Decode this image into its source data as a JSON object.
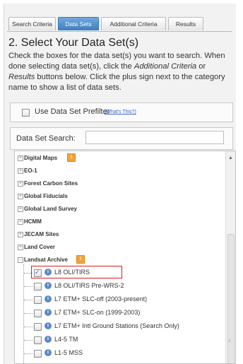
{
  "tabs": [
    {
      "label": "Search Criteria",
      "active": false
    },
    {
      "label": "Data Sets",
      "active": true
    },
    {
      "label": "Additional Criteria",
      "active": false
    },
    {
      "label": "Results",
      "active": false
    }
  ],
  "section": {
    "title": "2. Select Your Data Set(s)",
    "instr_1": "Check the boxes for the data set(s) you want to search. When done selecting data set(s), click the ",
    "instr_additional": "Additional Criteria",
    "instr_2": " or ",
    "instr_results": "Results",
    "instr_3": " buttons below. Click the plus sign next to the category name to show a list of data sets."
  },
  "prefilter": {
    "label": "Use Data Set Prefilter",
    "link": "(What's This?)",
    "checked": false
  },
  "search": {
    "label": "Data Set Search:",
    "value": "",
    "placeholder": ""
  },
  "tree": {
    "categories": [
      {
        "label": "Digital Maps",
        "badge": true
      },
      {
        "label": "EO-1",
        "badge": false
      },
      {
        "label": "Forest Carbon Sites",
        "badge": false
      },
      {
        "label": "Global Fiducials",
        "badge": false
      },
      {
        "label": "Global Land Survey",
        "badge": false
      },
      {
        "label": "HCMM",
        "badge": false
      },
      {
        "label": "JECAM Sites",
        "badge": false
      },
      {
        "label": "Land Cover",
        "badge": false
      },
      {
        "label": "Landsat Archive",
        "badge": true,
        "expanded": true
      }
    ],
    "datasets": [
      {
        "label": "L8 OLI/TIRS",
        "checked": true,
        "highlighted": true
      },
      {
        "label": "L8 OLI/TIRS Pre-WRS-2",
        "checked": false
      },
      {
        "label": "L7 ETM+ SLC-off (2003-present)",
        "checked": false
      },
      {
        "label": "L7 ETM+ SLC-on (1999-2003)",
        "checked": false
      },
      {
        "label": "L7 ETM+ Intl Ground Stations (Search Only)",
        "checked": false
      },
      {
        "label": "L4-5 TM",
        "checked": false
      },
      {
        "label": "L1-5 MSS",
        "checked": false
      }
    ]
  },
  "colors": {
    "active_tab": "#4a8bd0",
    "highlight_border": "#e21b1b",
    "badge": "#f2a33a",
    "link": "#3a5fcd"
  }
}
